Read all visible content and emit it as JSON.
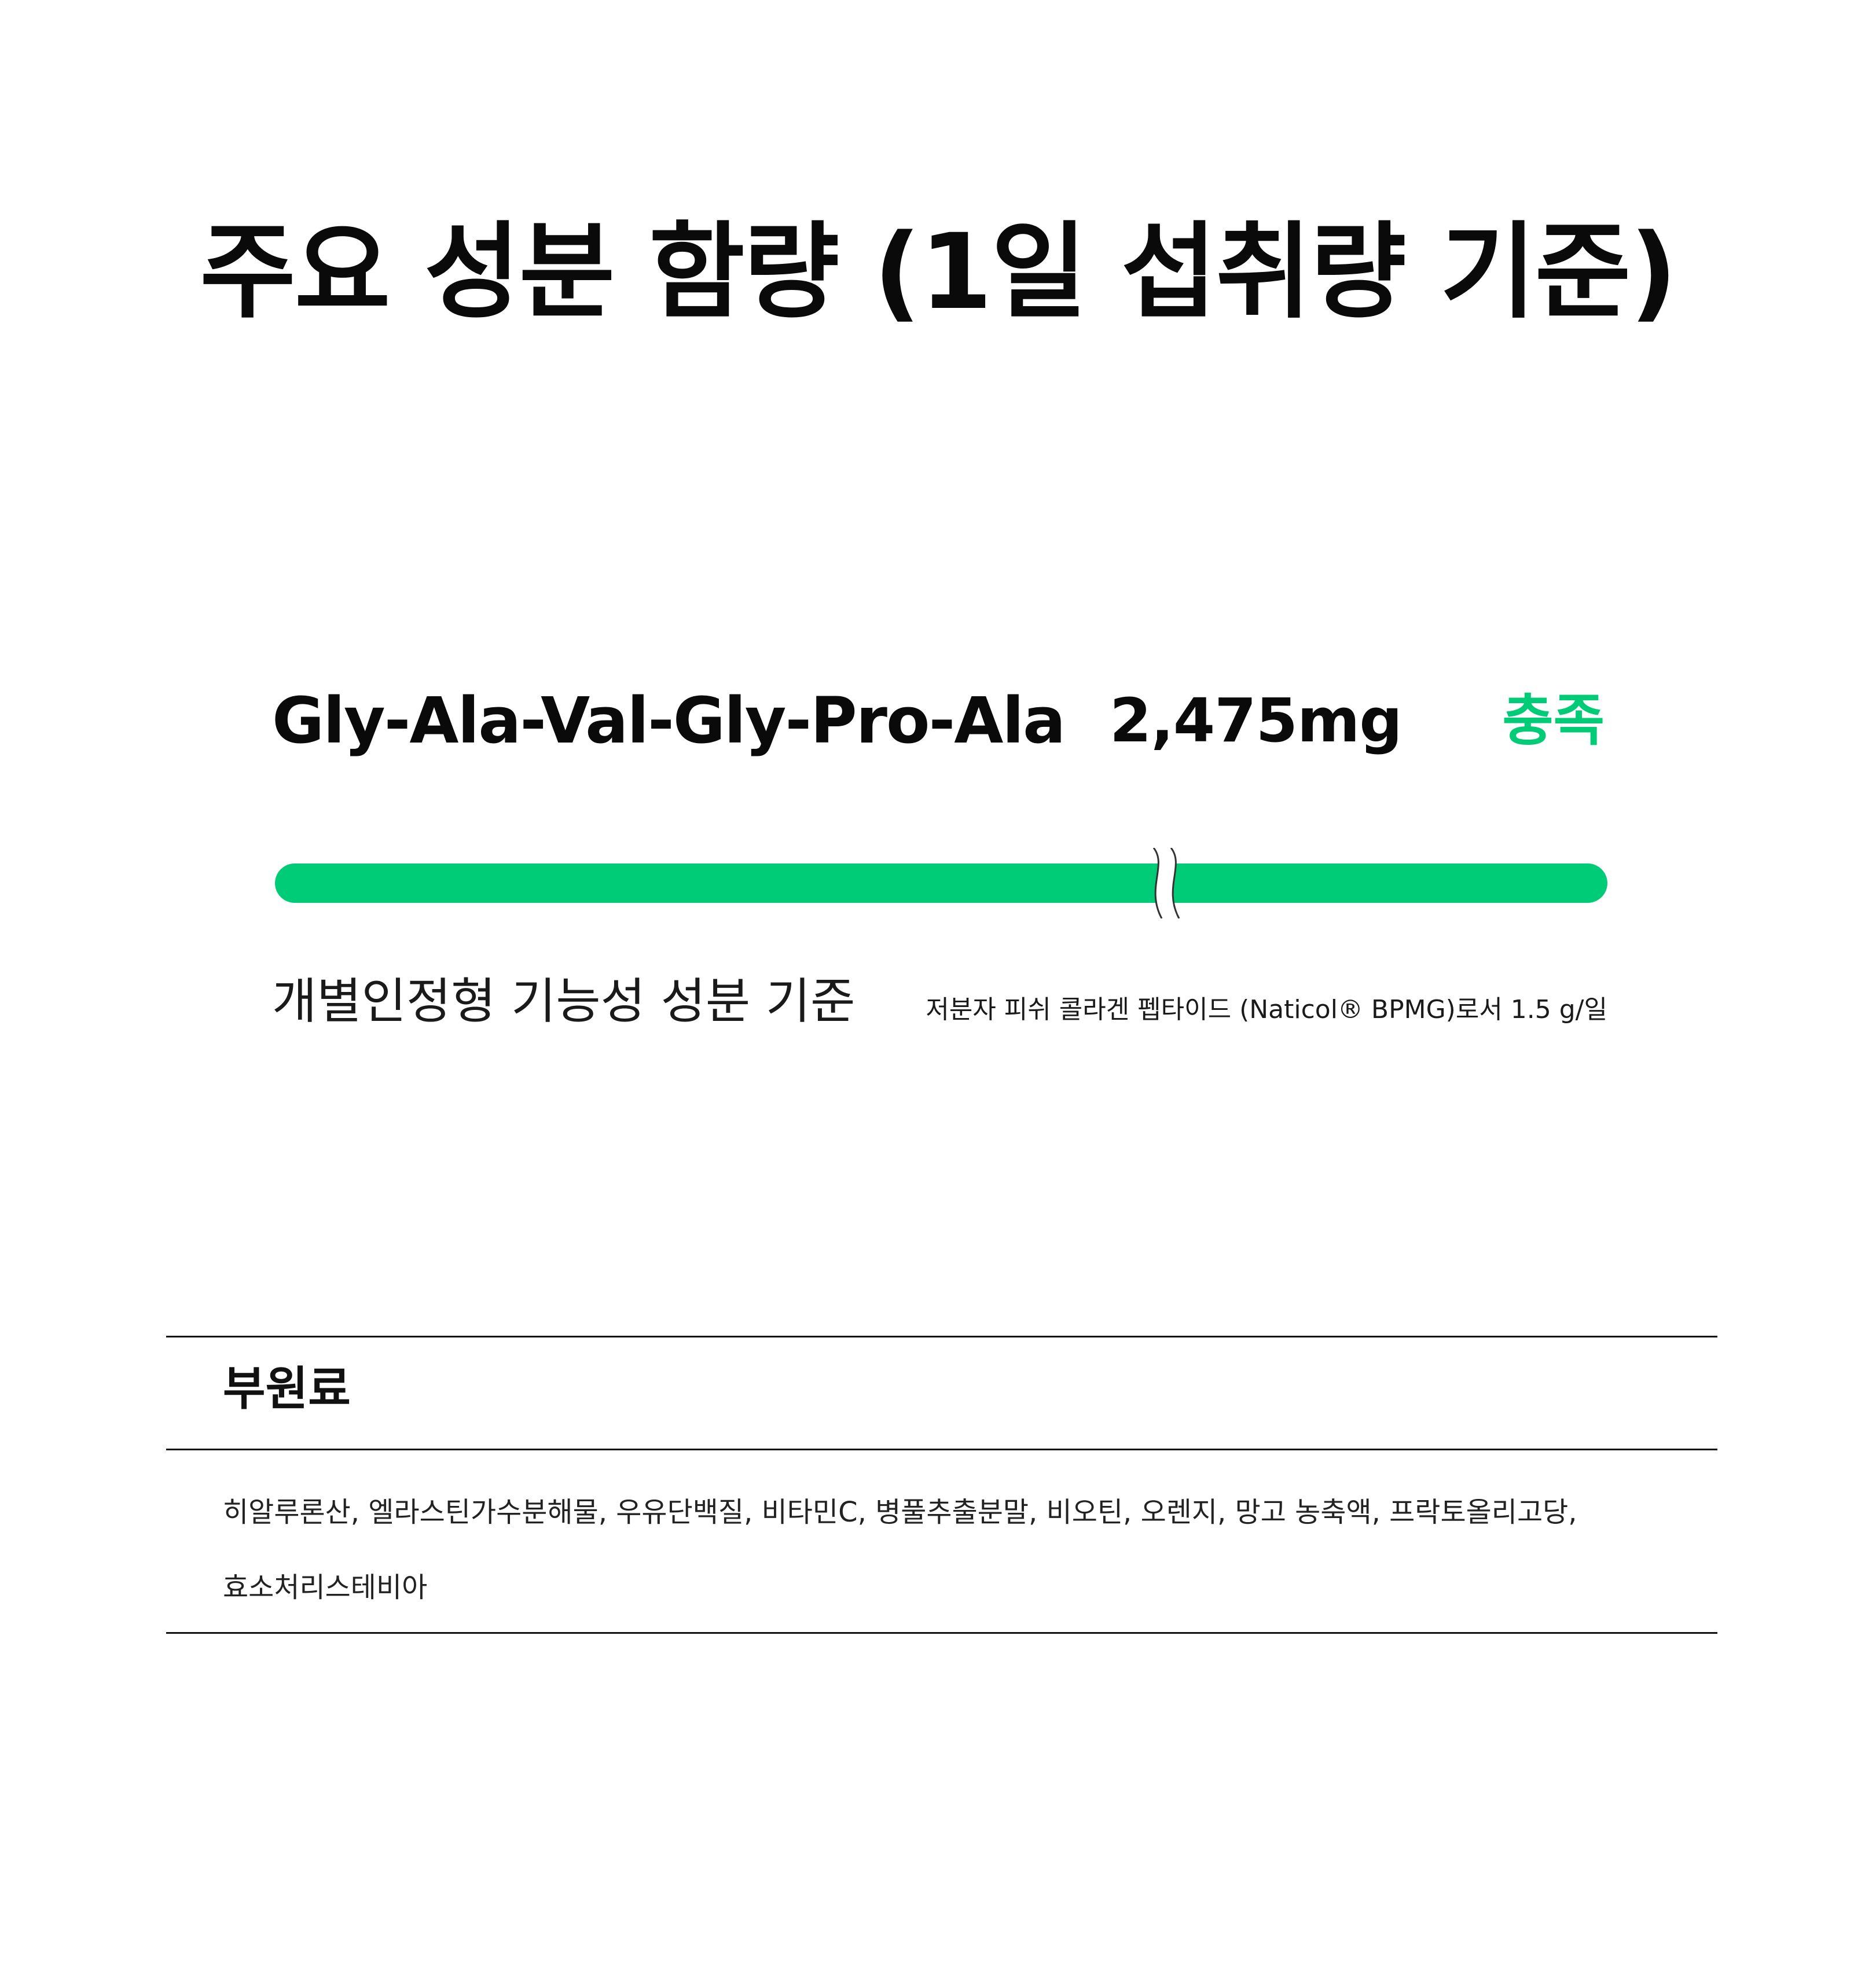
{
  "title": "주요 성분 함량 (1일 섭취량 기준)",
  "ingredient": {
    "name": "Gly-Ala-Val-Gly-Pro-Ala",
    "amount": "2,475mg",
    "status": "충족",
    "fill_fraction": 1.0,
    "standard_label": "개별인정형 기능성 성분 기준",
    "standard_note": "저분자 피쉬 콜라겐 펩타이드 (Naticol® BPMG)로서 1.5 g/일"
  },
  "sub_ingredients": {
    "heading": "부원료",
    "lines": [
      "히알루론산, 엘라스틴가수분해물, 우유단백질, 비타민C, 병풀추출분말, 비오틴, 오렌지, 망고 농축액, 프락토올리고당,",
      "효소처리스테비아"
    ]
  },
  "colors": {
    "accent": "#00CC77",
    "text": "#111111",
    "rule": "#111111",
    "background": "#FFFFFF"
  }
}
